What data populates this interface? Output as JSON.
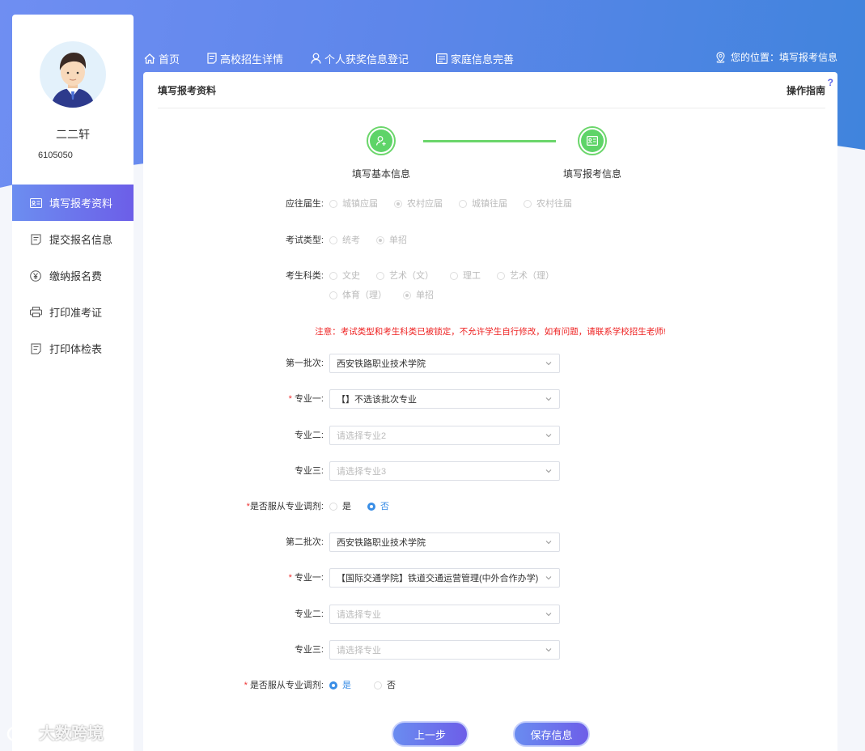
{
  "user": {
    "name": "二二轩",
    "id": "6105050"
  },
  "sidebar": {
    "items": [
      {
        "label": "填写报考资料",
        "icon": "id-card-icon",
        "active": true
      },
      {
        "label": "提交报名信息",
        "icon": "document-icon",
        "active": false
      },
      {
        "label": "缴纳报名费",
        "icon": "yen-icon",
        "active": false
      },
      {
        "label": "打印准考证",
        "icon": "printer-icon",
        "active": false
      },
      {
        "label": "打印体检表",
        "icon": "document-icon",
        "active": false
      }
    ]
  },
  "topnav": {
    "items": [
      {
        "label": "首页",
        "icon": "home-icon"
      },
      {
        "label": "高校招生详情",
        "icon": "document-icon"
      },
      {
        "label": "个人获奖信息登记",
        "icon": "user-icon"
      },
      {
        "label": "家庭信息完善",
        "icon": "id-card-icon"
      }
    ],
    "location_label": "您的位置：填写报考信息"
  },
  "card": {
    "title": "填写报考资料",
    "guide": "操作指南",
    "guide_mark": "?"
  },
  "steps": [
    {
      "label": "填写基本信息",
      "icon": "user-add-icon"
    },
    {
      "label": "填写报考信息",
      "icon": "id-card-icon"
    }
  ],
  "form": {
    "grad_type": {
      "label": "应往届生:",
      "options": [
        "城镇应届",
        "农村应届",
        "城镇往届",
        "农村往届"
      ],
      "selected": "农村应届"
    },
    "exam_type": {
      "label": "考试类型:",
      "options": [
        "统考",
        "单招"
      ],
      "selected": "单招"
    },
    "subject": {
      "label": "考生科类:",
      "options": [
        "文史",
        "艺术（文）",
        "理工",
        "艺术（理）",
        "体育（理）",
        "单招"
      ],
      "selected": "单招"
    },
    "notice": "注意：考试类型和考生科类已被锁定，不允许学生自行修改，如有问题，请联系学校招生老师!",
    "batch1": {
      "label": "第一批次:",
      "value": "西安铁路职业技术学院",
      "major1_label": "专业一:",
      "major1_value": "【】不选该批次专业",
      "major2_label": "专业二:",
      "major2_placeholder": "请选择专业2",
      "major3_label": "专业三:",
      "major3_placeholder": "请选择专业3",
      "adjust_label": "是否服从专业调剂:",
      "adjust_yes": "是",
      "adjust_no": "否",
      "adjust_selected": "否"
    },
    "batch2": {
      "label": "第二批次:",
      "value": "西安铁路职业技术学院",
      "major1_label": "专业一:",
      "major1_value": "【国际交通学院】铁道交通运营管理(中外合作办学)",
      "major2_label": "专业二:",
      "major2_placeholder": "请选择专业",
      "major3_label": "专业三:",
      "major3_placeholder": "请选择专业",
      "adjust_label": "是否服从专业调剂:",
      "adjust_yes": "是",
      "adjust_no": "否",
      "adjust_selected": "是"
    }
  },
  "buttons": {
    "prev": "上一步",
    "save": "保存信息"
  },
  "watermark": "大数跨境",
  "colors": {
    "accent": "#6c5ee8",
    "step_green": "#5ed468",
    "radio_blue": "#3a8ee6",
    "notice_red": "#e22222"
  }
}
